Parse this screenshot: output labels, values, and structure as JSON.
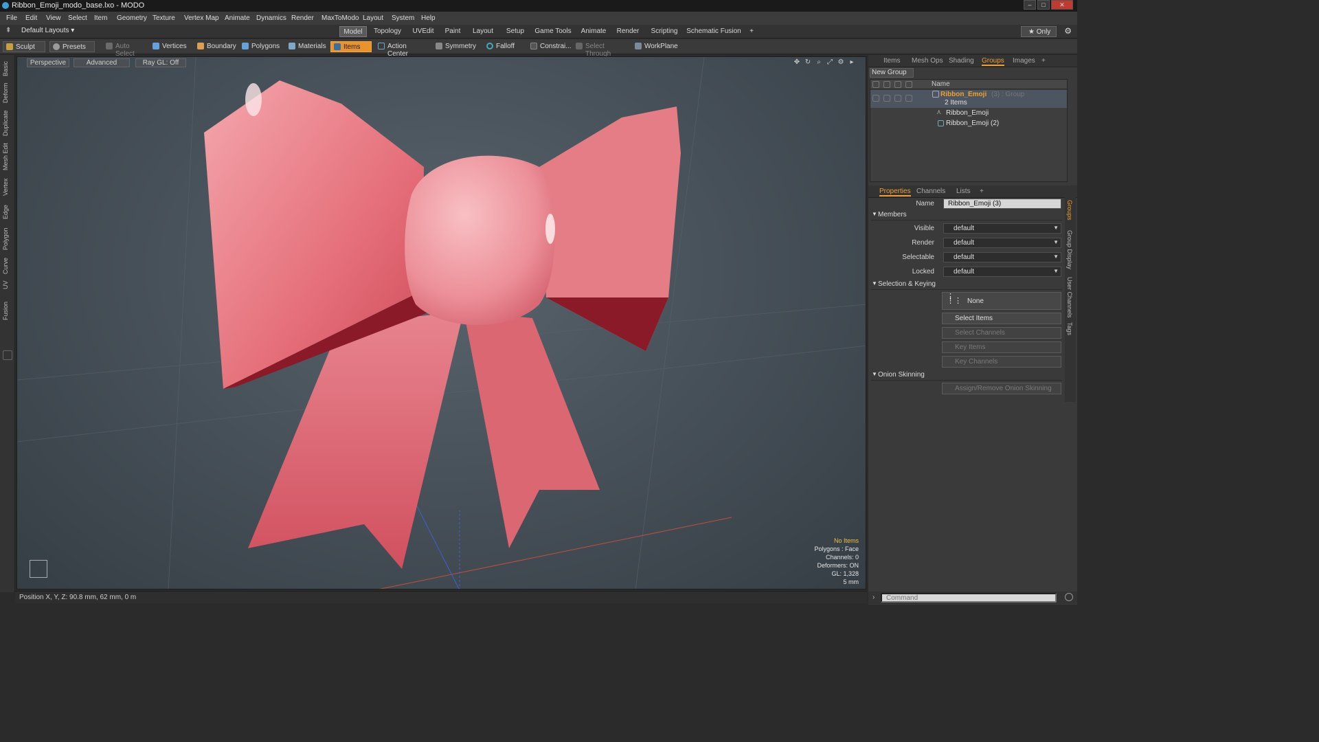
{
  "window": {
    "title": "Ribbon_Emoji_modo_base.lxo - MODO",
    "buttons": {
      "minimize": "–",
      "maximize": "□",
      "close": "✕"
    }
  },
  "menu": [
    "File",
    "Edit",
    "View",
    "Select",
    "Item",
    "Geometry",
    "Texture",
    "Vertex Map",
    "Animate",
    "Dynamics",
    "Render",
    "MaxToModo",
    "Layout",
    "System",
    "Help"
  ],
  "layout_bar": {
    "layouts_label": "Default Layouts ▾",
    "tabs": [
      "Model",
      "Topology",
      "UVEdit",
      "Paint",
      "Layout",
      "Setup",
      "Game Tools",
      "Animate",
      "Render",
      "Scripting",
      "Schematic Fusion"
    ],
    "active_tab": "Model",
    "add": "+",
    "only": "★ Only"
  },
  "toolbar": {
    "sculpt": "Sculpt",
    "presets": "Presets",
    "auto_select": "Auto Select",
    "vertices": "Vertices",
    "boundary": "Boundary",
    "polygons": "Polygons",
    "materials": "Materials",
    "items": "Items",
    "action_center": "Action Center",
    "symmetry": "Symmetry",
    "falloff": "Falloff",
    "constraints": "Constrai...",
    "select_through": "Select Through",
    "workplane": "WorkPlane"
  },
  "left_tabs": [
    "Basic",
    "Deform",
    "Duplicate",
    "Mesh Edit",
    "Vertex",
    "Edge",
    "Polygon",
    "Curve",
    "UV",
    "Fusion"
  ],
  "viewport": {
    "perspective": "Perspective",
    "advanced": "Advanced",
    "raygl": "Ray GL: Off",
    "info": {
      "no_items": "No Items",
      "polygons": "Polygons : Face",
      "channels": "Channels: 0",
      "deformers": "Deformers: ON",
      "gl": "GL: 1,328",
      "scale": "5 mm"
    }
  },
  "status": {
    "position": "Position X, Y, Z:  90.8 mm, 62 mm, 0 m"
  },
  "item_panel": {
    "tabs": [
      "Items",
      "Mesh Ops",
      "Shading",
      "Groups",
      "Images",
      "+"
    ],
    "active_tab": "Groups",
    "new_group": "New Group",
    "column_name": "Name",
    "group_name": "Ribbon_Emoji",
    "group_suffix": "(3) : Group",
    "group_count": "2 Items",
    "children": [
      "Ribbon_Emoji",
      "Ribbon_Emoji (2)"
    ]
  },
  "properties": {
    "tabs": [
      "Properties",
      "Channels",
      "Lists",
      "+"
    ],
    "active_tab": "Properties",
    "name_label": "Name",
    "name_value": "Ribbon_Emoji (3)",
    "members_section": "Members",
    "visible_label": "Visible",
    "visible_value": "default",
    "render_label": "Render",
    "render_value": "default",
    "selectable_label": "Selectable",
    "selectable_value": "default",
    "locked_label": "Locked",
    "locked_value": "default",
    "selkey_section": "Selection & Keying",
    "none_btn": "None",
    "select_items": "Select Items",
    "select_channels": "Select Channels",
    "key_items": "Key Items",
    "key_channels": "Key Channels",
    "onion_section": "Onion Skinning",
    "onion_btn": "Assign/Remove Onion Skinning",
    "side_tabs": [
      "Groups",
      "Group Display",
      "User Channels",
      "Tags"
    ]
  },
  "command": {
    "placeholder": "Command"
  },
  "colors": {
    "accent": "#f0a030",
    "ribbon": "#e06070",
    "viewport": "#4a545c"
  }
}
